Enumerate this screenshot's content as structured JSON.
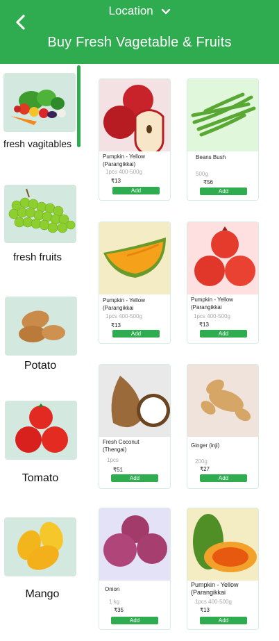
{
  "header": {
    "location_label": "Location",
    "title": "Buy Fresh Vagetable & Fruits",
    "bg_color": "#2fac4f"
  },
  "categories": [
    {
      "label": "fresh vagitables",
      "icon": "vegetables-image",
      "selected": true
    },
    {
      "label": "fresh fruits",
      "icon": "grapes-image"
    },
    {
      "label": "Potato",
      "icon": "potato-image"
    },
    {
      "label": "Tomato",
      "icon": "tomato-image"
    },
    {
      "label": "Mango",
      "icon": "mango-image"
    }
  ],
  "products": [
    {
      "name": "Pumpkin - Yellow (Parangikkai)",
      "qty": "1pcs 400-500g",
      "price": "₹13",
      "add": "Add",
      "image": "apple-image"
    },
    {
      "name": "Beans Bush",
      "qty": "500g",
      "price": "₹56",
      "add": "Add",
      "image": "beans-image"
    },
    {
      "name": "Pumpkin - Yellow (Parangikkai",
      "qty": "1pcs 400-500g",
      "price": "₹13",
      "add": "Add",
      "image": "pumpkin-image"
    },
    {
      "name": "Pumpkin - Yellow (Parangikkai",
      "qty": "1pcs 400-500g",
      "price": "₹13",
      "add": "Add",
      "image": "pomegranate-image"
    },
    {
      "name": "Fresh Coconut (Thengai)",
      "qty": "1pcs",
      "price": "₹51",
      "add": "Add",
      "image": "coconut-image"
    },
    {
      "name": "Ginger (inji)",
      "qty": "200g",
      "price": "₹27",
      "add": "Add",
      "image": "ginger-image"
    },
    {
      "name": "Onion",
      "qty": "1 kg",
      "price": "₹35",
      "add": "Add",
      "image": "onion-image"
    },
    {
      "name": "Pumpkin - Yellow (Parangikkai",
      "qty": "1pcs 400-500g",
      "price": "₹13",
      "add": "Add",
      "image": "papaya-image"
    }
  ]
}
